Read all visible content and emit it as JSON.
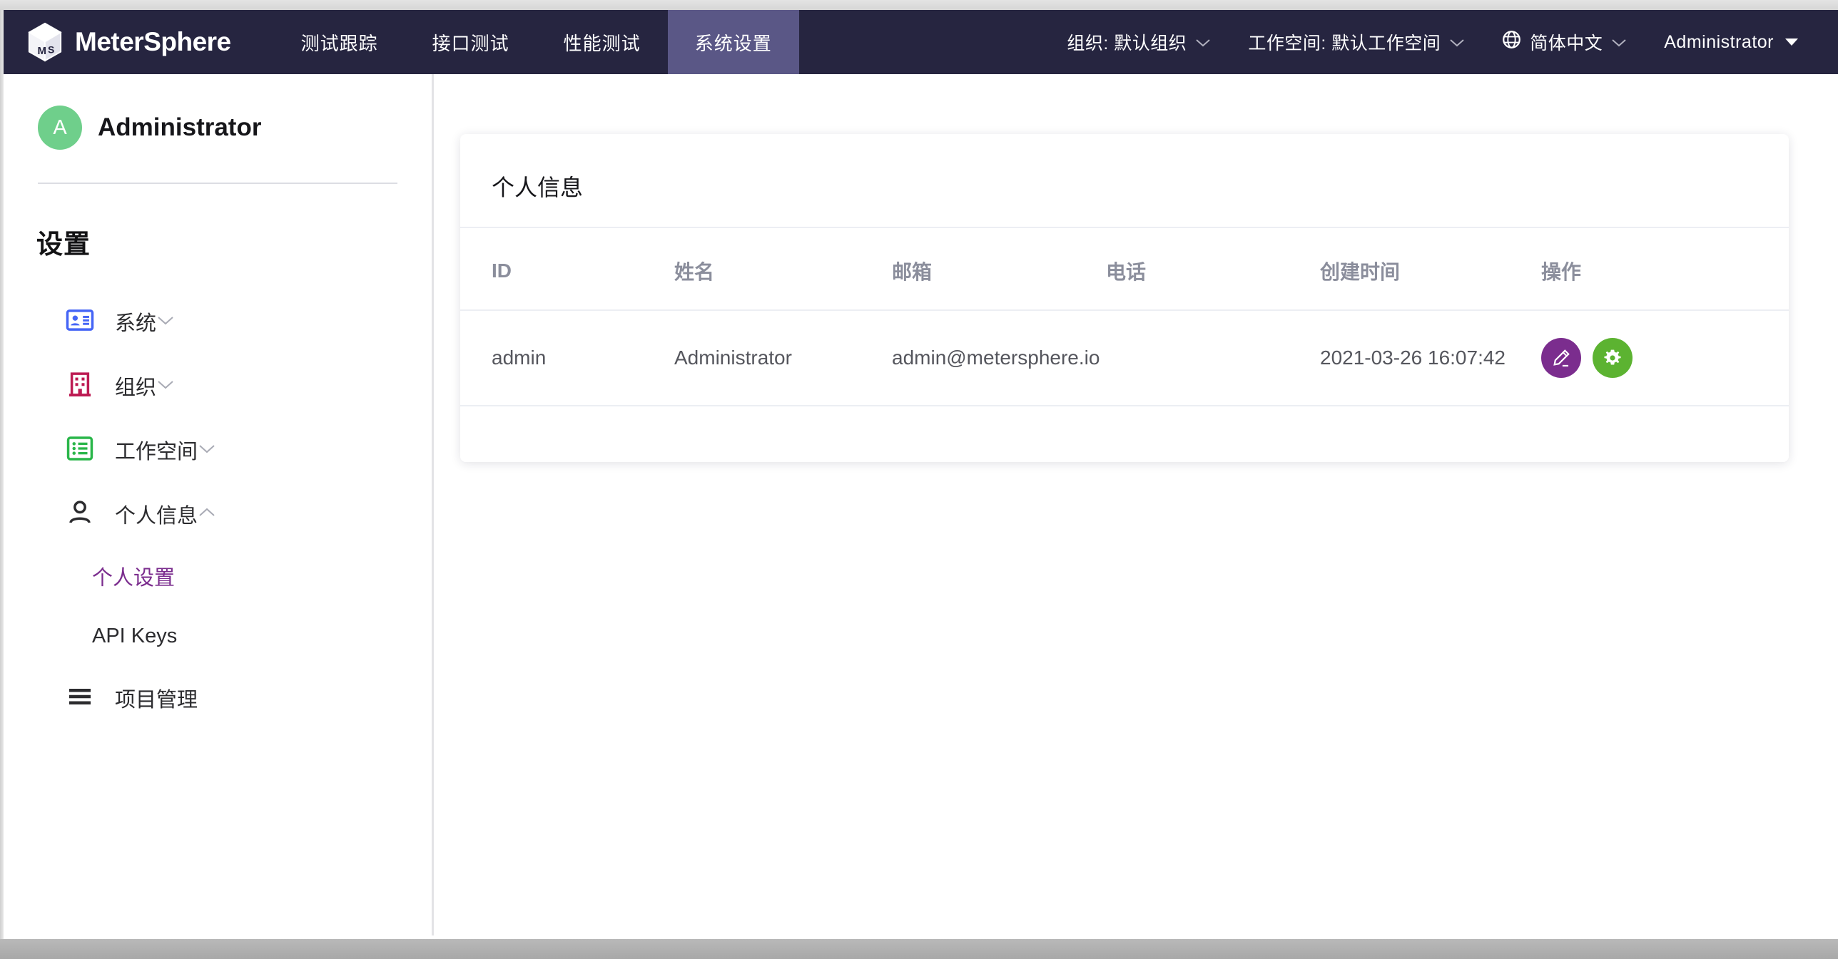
{
  "brand": {
    "name": "MeterSphere",
    "logo_icon": "ms-cube-logo-icon"
  },
  "topnav": {
    "tabs": [
      {
        "label": "测试跟踪",
        "active": false
      },
      {
        "label": "接口测试",
        "active": false
      },
      {
        "label": "性能测试",
        "active": false
      },
      {
        "label": "系统设置",
        "active": true
      }
    ],
    "org_selector": {
      "label": "组织: 默认组织",
      "icon": "chevron-down-icon"
    },
    "workspace_selector": {
      "label": "工作空间: 默认工作空间",
      "icon": "chevron-down-icon"
    },
    "language_selector": {
      "label": "简体中文",
      "icon": "globe-icon",
      "chevron": "chevron-down-icon"
    },
    "user_menu": {
      "label": "Administrator",
      "icon": "caret-down-icon"
    },
    "active_tab_color": "#5a5786",
    "bar_color": "#262540"
  },
  "sidebar": {
    "user": {
      "avatar_initial": "A",
      "avatar_color": "#6fcf8b",
      "name": "Administrator"
    },
    "section_title": "设置",
    "items": [
      {
        "label": "系统",
        "icon": "id-card-icon",
        "icon_color": "#4565f6",
        "chevron": "chevron-down-icon",
        "expanded": false
      },
      {
        "label": "组织",
        "icon": "building-icon",
        "icon_color": "#bd1b53",
        "chevron": "chevron-down-icon",
        "expanded": false
      },
      {
        "label": "工作空间",
        "icon": "list-box-icon",
        "icon_color": "#2ab64a",
        "chevron": "chevron-down-icon",
        "expanded": false
      },
      {
        "label": "个人信息",
        "icon": "user-icon",
        "icon_color": "#2b2b2e",
        "chevron": "chevron-up-icon",
        "expanded": true
      }
    ],
    "subitems": [
      {
        "label": "个人设置",
        "active": true
      },
      {
        "label": "API Keys",
        "active": false
      }
    ],
    "footer_item": {
      "label": "项目管理",
      "icon": "hamburger-menu-icon",
      "icon_color": "#2b2b2e"
    },
    "active_color": "#7b2d8e"
  },
  "main": {
    "card_title": "个人信息",
    "table": {
      "columns": [
        "ID",
        "姓名",
        "邮箱",
        "电话",
        "创建时间",
        "操作"
      ],
      "rows": [
        {
          "id": "admin",
          "name": "Administrator",
          "email": "admin@metersphere.io",
          "phone": "",
          "created_at": "2021-03-26 16:07:42",
          "actions": [
            {
              "name": "edit-button",
              "icon": "pencil-icon",
              "color": "#7b2d8e"
            },
            {
              "name": "settings-button",
              "icon": "gear-icon",
              "color": "#5cb331"
            }
          ]
        }
      ]
    }
  }
}
